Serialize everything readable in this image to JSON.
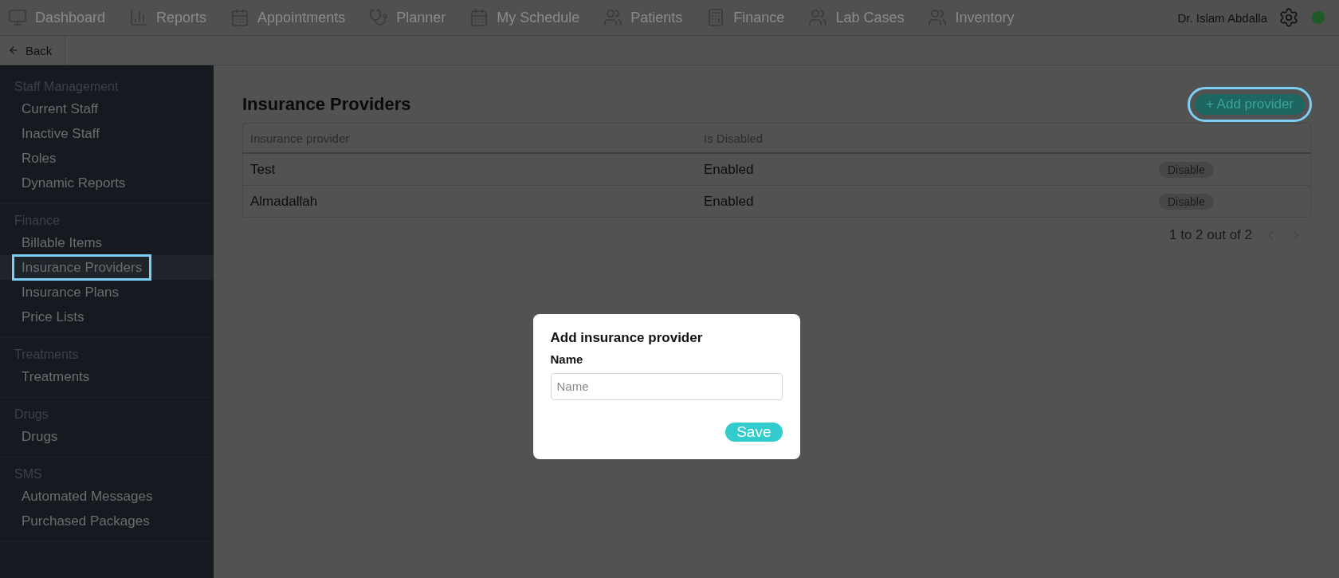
{
  "top_nav": {
    "items": [
      {
        "label": "Dashboard",
        "kind": "monitor"
      },
      {
        "label": "Reports",
        "kind": "chart"
      },
      {
        "label": "Appointments",
        "kind": "calendar"
      },
      {
        "label": "Planner",
        "kind": "planner"
      },
      {
        "label": "My Schedule",
        "kind": "calendar"
      },
      {
        "label": "Patients",
        "kind": "people"
      },
      {
        "label": "Finance",
        "kind": "calculator"
      },
      {
        "label": "Lab Cases",
        "kind": "people"
      },
      {
        "label": "Inventory",
        "kind": "people"
      }
    ],
    "user": "Dr. Islam Abdalla",
    "online": true
  },
  "back": {
    "label": "Back"
  },
  "sidebar": {
    "sections": [
      {
        "title": "Staff Management",
        "items": [
          {
            "label": "Current Staff",
            "selected": false
          },
          {
            "label": "Inactive Staff",
            "selected": false
          },
          {
            "label": "Roles",
            "selected": false
          },
          {
            "label": "Dynamic Reports",
            "selected": false
          }
        ]
      },
      {
        "title": "Finance",
        "items": [
          {
            "label": "Billable Items",
            "selected": false
          },
          {
            "label": "Insurance Providers",
            "selected": true
          },
          {
            "label": "Insurance Plans",
            "selected": false
          },
          {
            "label": "Price Lists",
            "selected": false
          }
        ]
      },
      {
        "title": "Treatments",
        "items": [
          {
            "label": "Treatments",
            "selected": false
          }
        ]
      },
      {
        "title": "Drugs",
        "items": [
          {
            "label": "Drugs",
            "selected": false
          }
        ]
      },
      {
        "title": "SMS",
        "items": [
          {
            "label": "Automated Messages",
            "selected": false
          },
          {
            "label": "Purchased Packages",
            "selected": false
          }
        ]
      }
    ]
  },
  "page": {
    "title": "Insurance Providers",
    "add_button": {
      "label": "+ Add provider",
      "highlighted": true
    }
  },
  "table": {
    "columns": [
      "Insurance provider",
      "Is Disabled"
    ],
    "rows": [
      {
        "name": "Test",
        "status": "Enabled",
        "action": "Disable"
      },
      {
        "name": "Almadallah",
        "status": "Enabled",
        "action": "Disable"
      }
    ]
  },
  "pagination": {
    "summary": "1 to 2 out of 2"
  },
  "modal": {
    "title": "Add insurance provider",
    "field_label": "Name",
    "placeholder": "Name",
    "save": "Save"
  }
}
